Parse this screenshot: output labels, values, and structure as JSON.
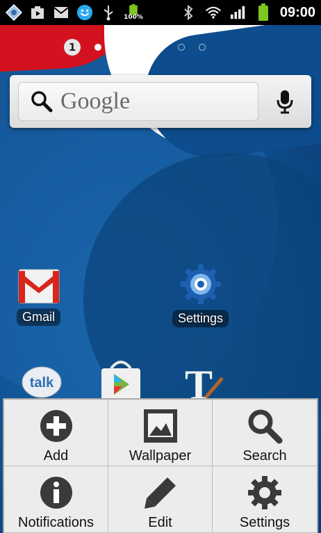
{
  "status_bar": {
    "battery_percent_label": "100%",
    "time": "09:00",
    "left_icons": [
      "notification-app-icon",
      "media-icon",
      "gmail-icon",
      "chat-icon",
      "usb-icon",
      "battery-low-icon"
    ],
    "right_icons": [
      "bluetooth-icon",
      "wifi-icon",
      "signal-icon",
      "battery-icon"
    ]
  },
  "home": {
    "current_page": "1",
    "page_count": 7,
    "search_widget": {
      "label": "Google",
      "voice_icon": "microphone-icon"
    },
    "shortcuts": [
      {
        "label": "Gmail",
        "icon": "gmail-icon"
      },
      {
        "label": "Settings",
        "icon": "settings-gear-icon"
      }
    ],
    "dock_partial_icons": [
      "talk-icon",
      "play-store-icon",
      "text-editor-icon"
    ]
  },
  "options_menu": {
    "items": [
      {
        "label": "Add",
        "icon": "add-icon"
      },
      {
        "label": "Wallpaper",
        "icon": "wallpaper-icon"
      },
      {
        "label": "Search",
        "icon": "search-icon"
      },
      {
        "label": "Notifications",
        "icon": "info-icon"
      },
      {
        "label": "Edit",
        "icon": "pencil-icon"
      },
      {
        "label": "Settings",
        "icon": "gear-icon"
      }
    ]
  },
  "colors": {
    "status_bar_bg": "#000000",
    "battery_green": "#7dc51f",
    "menu_bg": "#ececec",
    "menu_icon_dark": "#3a3a3a",
    "wallpaper_blue": "#0e4f8e",
    "wallpaper_red": "#d4121f"
  }
}
